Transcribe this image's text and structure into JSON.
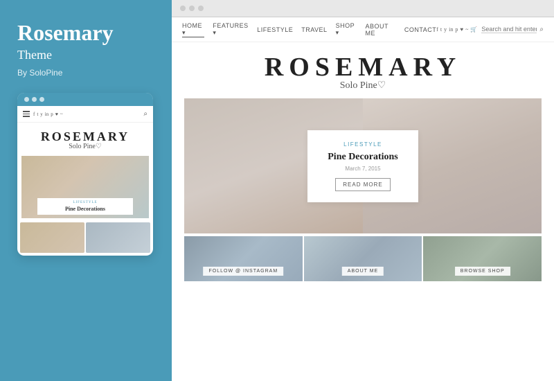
{
  "left": {
    "title": "Rosemary",
    "subtitle": "Theme",
    "author": "By SoloPine",
    "mobile": {
      "nav_items": [
        "f",
        "t",
        "y",
        "in",
        "p",
        "♥",
        "rss"
      ],
      "logo_text": "ROSEMARY",
      "logo_sub": "Solo Pine♡",
      "featured_category": "LIFESTYLE",
      "featured_title": "Pine Decorations"
    }
  },
  "right": {
    "browser_dots": [
      "●",
      "●",
      "●"
    ],
    "nav": {
      "links": [
        "HOME",
        "FEATURES",
        "LIFESTYLE",
        "TRAVEL",
        "SHOP",
        "ABOUT ME",
        "CONTACT"
      ],
      "social": [
        "f",
        "t",
        "y",
        "in",
        "p",
        "♥",
        "rss"
      ],
      "search_placeholder": "Search and hit enter..."
    },
    "logo_text": "ROSEMARY",
    "logo_sub": "Solo Pine♡",
    "featured": {
      "category": "LIFESTYLE",
      "title": "Pine Decorations",
      "date": "March 7, 2015",
      "btn_label": "READ MORE"
    },
    "bottom_cols": [
      {
        "label": "FOLLOW @ INSTAGRAM"
      },
      {
        "label": "ABOUT ME"
      },
      {
        "label": "BROWSE SHOP"
      }
    ]
  }
}
